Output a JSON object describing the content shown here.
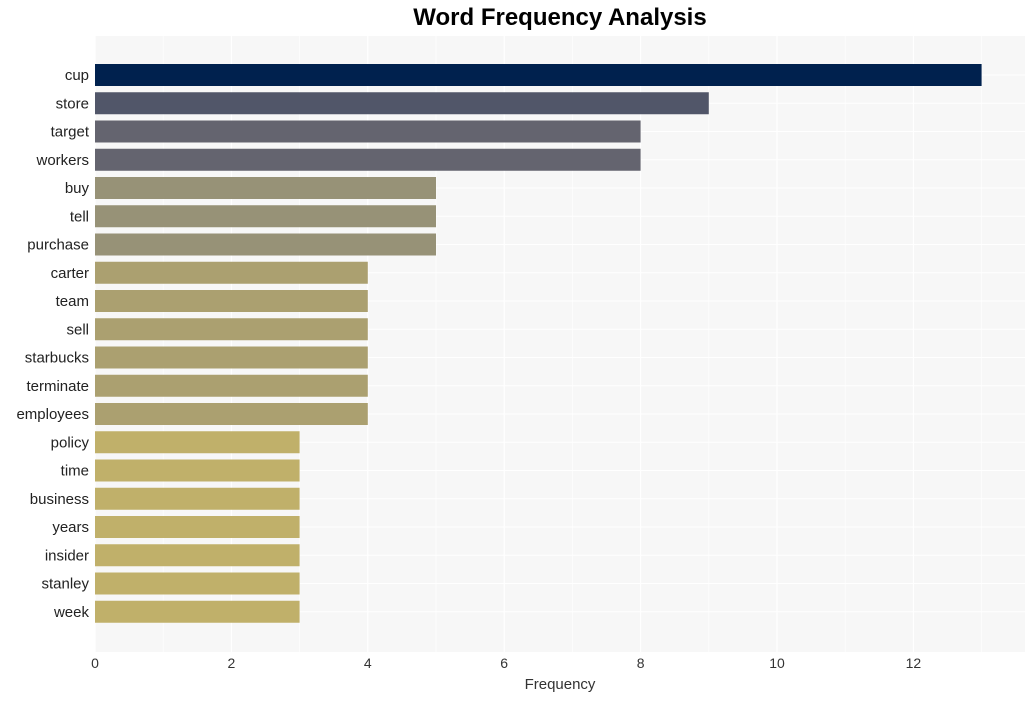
{
  "chart_data": {
    "type": "bar",
    "orientation": "horizontal",
    "title": "Word Frequency Analysis",
    "xlabel": "Frequency",
    "ylabel": "",
    "xlim": [
      0,
      13.6
    ],
    "xticks": [
      0,
      2,
      4,
      6,
      8,
      10,
      12
    ],
    "grid": true,
    "legend": "none",
    "categories": [
      "cup",
      "store",
      "target",
      "workers",
      "buy",
      "tell",
      "purchase",
      "carter",
      "team",
      "sell",
      "starbucks",
      "terminate",
      "employees",
      "policy",
      "time",
      "business",
      "years",
      "insider",
      "stanley",
      "week"
    ],
    "values": [
      13,
      9,
      8,
      8,
      5,
      5,
      5,
      4,
      4,
      4,
      4,
      4,
      4,
      3,
      3,
      3,
      3,
      3,
      3,
      3
    ],
    "colors": {
      "13": "#00214e",
      "9": "#515669",
      "8": "#64646f",
      "5": "#979277",
      "4": "#aba070",
      "3": "#c0b06a"
    },
    "background": "#f7f7f7"
  }
}
